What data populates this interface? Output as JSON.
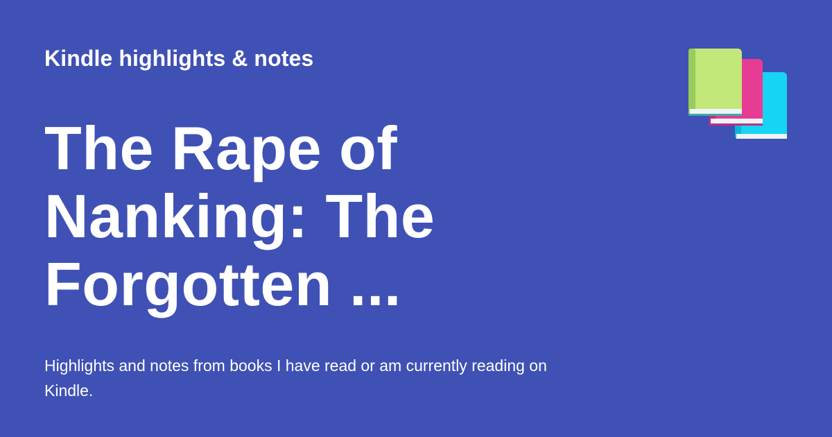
{
  "header": {
    "site_name": "Kindle highlights & notes"
  },
  "main": {
    "title": "The Rape of Nanking: The Forgotten ...",
    "description": "Highlights and notes from books I have read or am currently reading on Kindle."
  },
  "decor": {
    "icon": "books-icon",
    "colors": {
      "background": "#3f51b5",
      "book_green": "#c2e87a",
      "book_green_spine": "#97cc5a",
      "book_pink": "#e63c93",
      "book_pink_spine": "#c52c7c",
      "book_cyan": "#15d4f4",
      "book_cyan_spine": "#0ab6d7",
      "pages": "#eef4f7"
    }
  }
}
